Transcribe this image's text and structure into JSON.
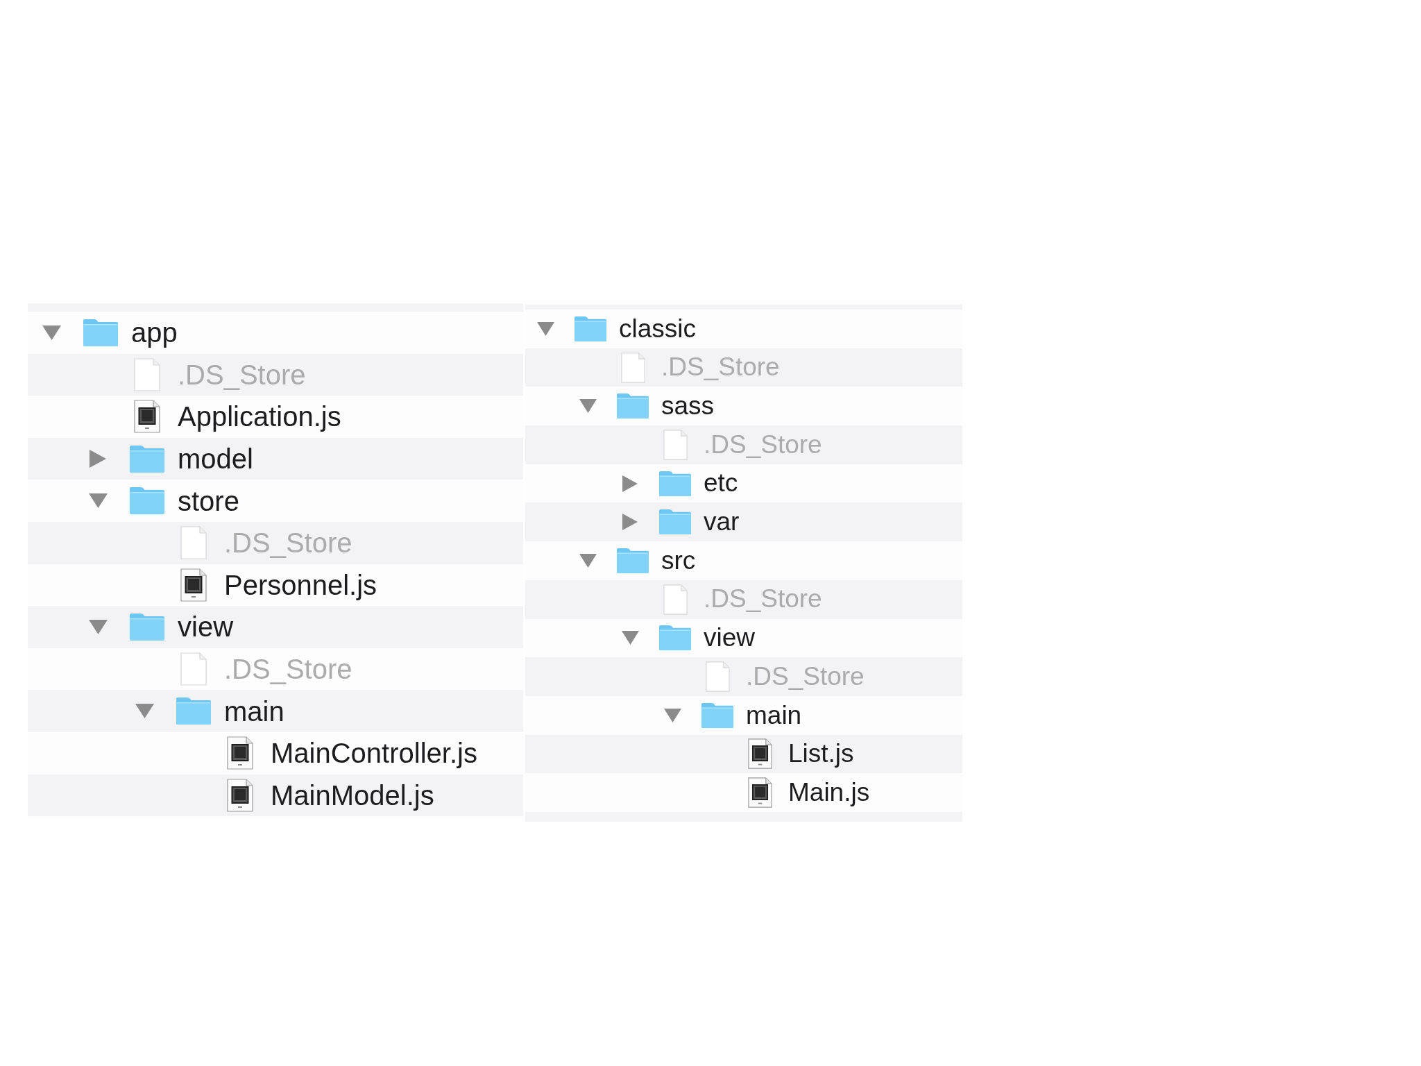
{
  "panes": [
    {
      "tree": [
        {
          "name": "app",
          "kind": "folder",
          "expanded": true,
          "children": [
            {
              "name": ".DS_Store",
              "kind": "dotfile"
            },
            {
              "name": "Application.js",
              "kind": "script"
            },
            {
              "name": "model",
              "kind": "folder",
              "expanded": false
            },
            {
              "name": "store",
              "kind": "folder",
              "expanded": true,
              "children": [
                {
                  "name": ".DS_Store",
                  "kind": "dotfile"
                },
                {
                  "name": "Personnel.js",
                  "kind": "script"
                }
              ]
            },
            {
              "name": "view",
              "kind": "folder",
              "expanded": true,
              "children": [
                {
                  "name": ".DS_Store",
                  "kind": "dotfile"
                },
                {
                  "name": "main",
                  "kind": "folder",
                  "expanded": true,
                  "children": [
                    {
                      "name": "MainController.js",
                      "kind": "script"
                    },
                    {
                      "name": "MainModel.js",
                      "kind": "script"
                    }
                  ]
                }
              ]
            }
          ]
        }
      ]
    },
    {
      "tree": [
        {
          "name": "classic",
          "kind": "folder",
          "expanded": true,
          "children": [
            {
              "name": ".DS_Store",
              "kind": "dotfile"
            },
            {
              "name": "sass",
              "kind": "folder",
              "expanded": true,
              "children": [
                {
                  "name": ".DS_Store",
                  "kind": "dotfile"
                },
                {
                  "name": "etc",
                  "kind": "folder",
                  "expanded": false
                },
                {
                  "name": "var",
                  "kind": "folder",
                  "expanded": false
                }
              ]
            },
            {
              "name": "src",
              "kind": "folder",
              "expanded": true,
              "children": [
                {
                  "name": ".DS_Store",
                  "kind": "dotfile"
                },
                {
                  "name": "view",
                  "kind": "folder",
                  "expanded": true,
                  "children": [
                    {
                      "name": ".DS_Store",
                      "kind": "dotfile"
                    },
                    {
                      "name": "main",
                      "kind": "folder",
                      "expanded": true,
                      "children": [
                        {
                          "name": "List.js",
                          "kind": "script"
                        },
                        {
                          "name": "Main.js",
                          "kind": "script"
                        }
                      ]
                    }
                  ]
                }
              ]
            }
          ]
        }
      ]
    }
  ]
}
